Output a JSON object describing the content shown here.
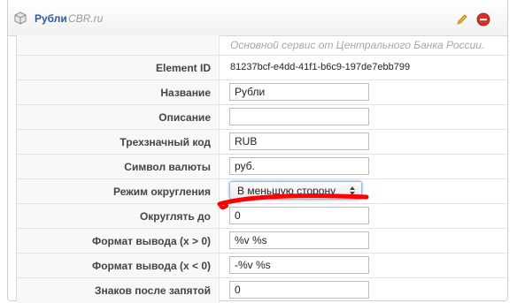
{
  "header": {
    "title": "Рубли",
    "subtitle": "CBR.ru",
    "icons": [
      "cube-icon",
      "edit-icon",
      "delete-icon"
    ]
  },
  "description": "Основной сервис от Центрального Банка России.",
  "fields": {
    "element_id": {
      "label": "Element ID",
      "value": "81237bcf-e4dd-41f1-b6c9-197de7ebb799"
    },
    "name": {
      "label": "Название",
      "value": "Рубли"
    },
    "description": {
      "label": "Описание",
      "value": ""
    },
    "code": {
      "label": "Трехзначный код",
      "value": "RUB"
    },
    "symbol": {
      "label": "Символ валюты",
      "value": "руб."
    },
    "rounding_mode": {
      "label": "Режим округления",
      "value": "В меньшую сторону"
    },
    "round_to": {
      "label": "Округлять до",
      "value": "0"
    },
    "format_positive": {
      "label": "Формат вывода (x > 0)",
      "value": "%v %s"
    },
    "format_negative": {
      "label": "Формат вывода (x < 0)",
      "value": "-%v %s"
    },
    "decimals": {
      "label": "Знаков после запятой",
      "value": "0"
    }
  },
  "colors": {
    "title": "#2d5aa0",
    "annotation": "#ff0000",
    "delete": "#d93025",
    "edit": "#f2b61b"
  }
}
